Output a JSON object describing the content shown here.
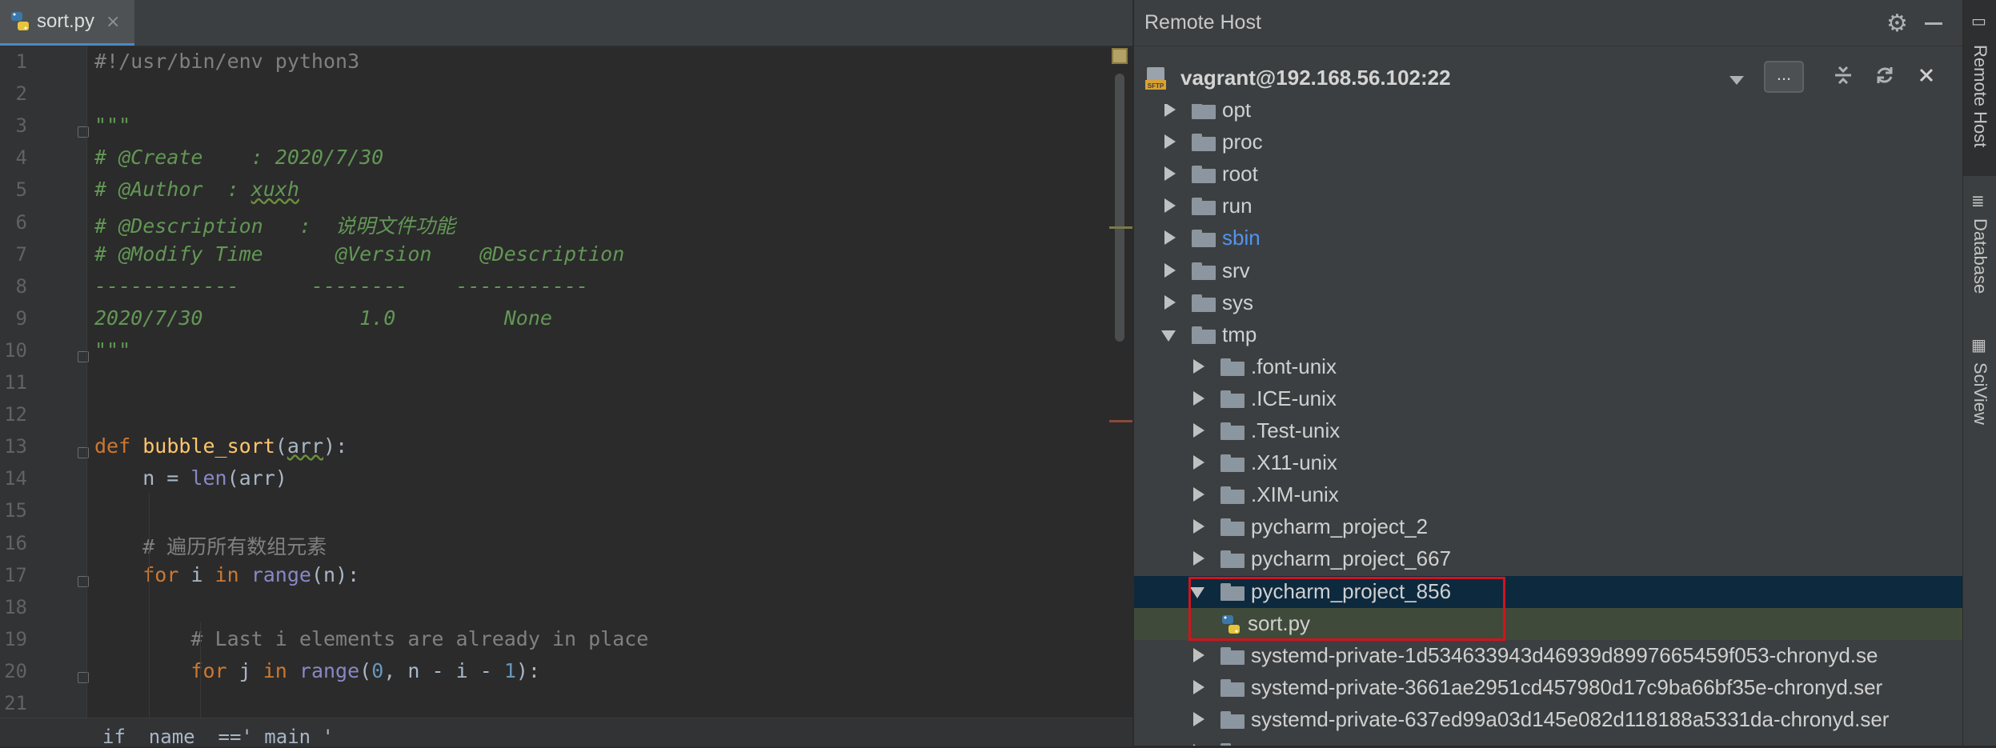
{
  "editor": {
    "tab": {
      "label": "sort.py",
      "close": "×"
    },
    "lines": [
      [
        [
          "#!/usr/bin/env python3",
          "comment"
        ]
      ],
      [],
      [
        [
          "\"\"\"",
          "doc"
        ]
      ],
      [
        [
          "# @Create    : 2020/7/30",
          "doc"
        ]
      ],
      [
        [
          "# @Author  : ",
          "doc"
        ],
        [
          "xuxh",
          "doc under"
        ]
      ],
      [
        [
          "# @Description   :  说明文件功能",
          "doc"
        ]
      ],
      [
        [
          "# @Modify Time      @Version    @Description",
          "doc"
        ]
      ],
      [
        [
          "------------      --------    -----------",
          "doc"
        ]
      ],
      [
        [
          "2020/7/30             1.0         None",
          "doc"
        ]
      ],
      [
        [
          "\"\"\"",
          "doc"
        ]
      ],
      [],
      [],
      [
        [
          "def ",
          "kw"
        ],
        [
          "bubble_sort",
          "fn"
        ],
        [
          "(",
          ""
        ],
        [
          "arr",
          "under"
        ],
        [
          "):",
          ""
        ]
      ],
      [
        [
          "    n = ",
          ""
        ],
        [
          "len",
          "builtin"
        ],
        [
          "(arr)",
          ""
        ]
      ],
      [],
      [
        [
          "    # 遍历所有数组元素",
          "comment"
        ]
      ],
      [
        [
          "    ",
          ""
        ],
        [
          "for ",
          "kw"
        ],
        [
          "i ",
          ""
        ],
        [
          "in ",
          "kw"
        ],
        [
          "range",
          "builtin"
        ],
        [
          "(n):",
          ""
        ]
      ],
      [],
      [
        [
          "        # Last i elements are already in place",
          "comment"
        ]
      ],
      [
        [
          "        ",
          ""
        ],
        [
          "for ",
          "kw"
        ],
        [
          "j ",
          ""
        ],
        [
          "in ",
          "kw"
        ],
        [
          "range",
          "builtin"
        ],
        [
          "(",
          ""
        ],
        [
          "0",
          "num"
        ],
        [
          ", n - i - ",
          ""
        ],
        [
          "1",
          "num"
        ],
        [
          "):",
          ""
        ]
      ],
      []
    ],
    "line_numbers": [
      "1",
      "2",
      "3",
      "4",
      "5",
      "6",
      "7",
      "8",
      "9",
      "10",
      "11",
      "12",
      "13",
      "14",
      "15",
      "16",
      "17",
      "18",
      "19",
      "20",
      "21"
    ],
    "bottom_hint": "if  name  ==' main '"
  },
  "panel": {
    "title": "Remote Host",
    "host": "vagrant@192.168.56.102:22",
    "more_label": "...",
    "tree": [
      {
        "name": "opt",
        "expanded": false,
        "depth": 0
      },
      {
        "name": "proc",
        "expanded": false,
        "depth": 0
      },
      {
        "name": "root",
        "expanded": false,
        "depth": 0
      },
      {
        "name": "run",
        "expanded": false,
        "depth": 0
      },
      {
        "name": "sbin",
        "expanded": false,
        "depth": 0,
        "link": true
      },
      {
        "name": "srv",
        "expanded": false,
        "depth": 0
      },
      {
        "name": "sys",
        "expanded": false,
        "depth": 0
      },
      {
        "name": "tmp",
        "expanded": true,
        "depth": 0
      },
      {
        "name": ".font-unix",
        "expanded": false,
        "depth": 1
      },
      {
        "name": ".ICE-unix",
        "expanded": false,
        "depth": 1
      },
      {
        "name": ".Test-unix",
        "expanded": false,
        "depth": 1
      },
      {
        "name": ".X11-unix",
        "expanded": false,
        "depth": 1
      },
      {
        "name": ".XIM-unix",
        "expanded": false,
        "depth": 1
      },
      {
        "name": "pycharm_project_2",
        "expanded": false,
        "depth": 1
      },
      {
        "name": "pycharm_project_667",
        "expanded": false,
        "depth": 1
      },
      {
        "name": "pycharm_project_856",
        "expanded": true,
        "depth": 1,
        "selected": true
      },
      {
        "name": "sort.py",
        "file": true,
        "depth": 2,
        "highlight": true
      },
      {
        "name": "systemd-private-1d534633943d46939d8997665459f053-chronyd.se",
        "expanded": false,
        "depth": 1
      },
      {
        "name": "systemd-private-3661ae2951cd457980d17c9ba66bf35e-chronyd.ser",
        "expanded": false,
        "depth": 1
      },
      {
        "name": "systemd-private-637ed99a03d145e082d118188a5331da-chronyd.ser",
        "expanded": false,
        "depth": 1
      },
      {
        "name": "",
        "expanded": false,
        "depth": 1
      }
    ]
  },
  "sidebar": {
    "items": [
      {
        "label": "Remote Host",
        "icon": "remote-host-icon"
      },
      {
        "label": "Database",
        "icon": "database-icon"
      },
      {
        "label": "SciView",
        "icon": "sciview-icon"
      }
    ]
  }
}
